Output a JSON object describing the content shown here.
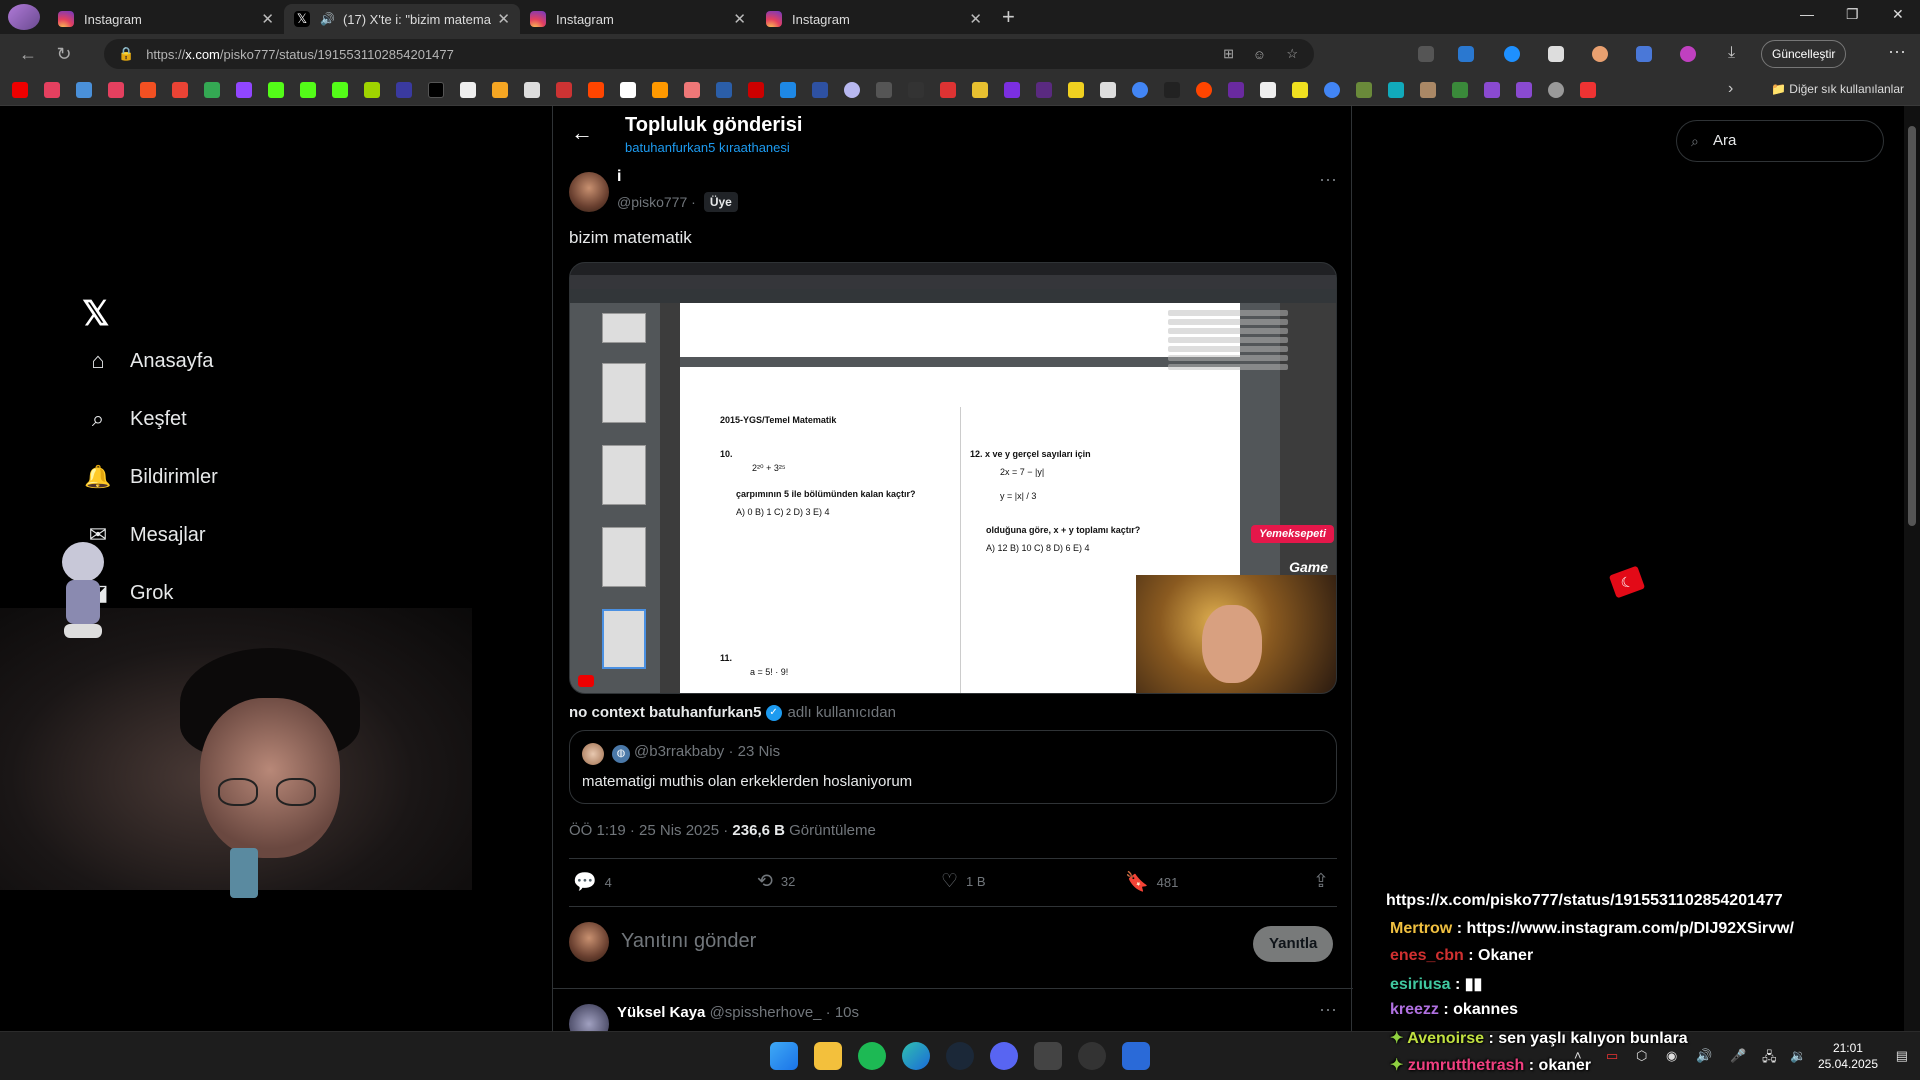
{
  "browser": {
    "tabs": [
      {
        "title": "Instagram",
        "icon": "instagram-icon"
      },
      {
        "title": "(17) X'te i: \"bizim matematik",
        "icon": "x-icon",
        "active": true,
        "audio": true
      },
      {
        "title": "Instagram",
        "icon": "instagram-icon"
      },
      {
        "title": "Instagram",
        "icon": "instagram-icon"
      }
    ],
    "new_tab": "+",
    "url_prefix": "https://",
    "url_domain": "x.com",
    "url_path": "/pisko777/status/1915531102854201477",
    "update_button": "Güncelleştir",
    "other_bookmarks": "Diğer sık kullanılanlar"
  },
  "nav": {
    "logo": "𝕏",
    "items": [
      {
        "label": "Anasayfa",
        "icon": "home-icon",
        "glyph": "⌂"
      },
      {
        "label": "Keşfet",
        "icon": "search-icon",
        "glyph": "⌕"
      },
      {
        "label": "Bildirimler",
        "icon": "bell-icon",
        "glyph": "🔔"
      },
      {
        "label": "Mesajlar",
        "icon": "mail-icon",
        "glyph": "✉"
      },
      {
        "label": "Grok",
        "icon": "grok-icon",
        "glyph": "◪"
      }
    ]
  },
  "header": {
    "title": "Topluluk gönderisi",
    "subtitle": "batuhanfurkan5 kıraathanesi"
  },
  "post": {
    "author": "i",
    "handle": "@pisko777 ·",
    "badge": "Üye",
    "text": "bizim matematik",
    "media": {
      "doc_title": "2015-YGS/Temel Matematik",
      "q10": "10.",
      "q10_expr": "2²⁰ + 3²⁵",
      "q10_text": "çarpımının 5 ile bölümünden kalan kaçtır?",
      "q10_opts": "A) 0      B) 1      C) 2      D) 3      E) 4",
      "q12": "12.  x ve y gerçel sayıları için",
      "q12_eq1": "2x = 7 − |y|",
      "q12_eq2": "y = |x| / 3",
      "q12_text": "olduğuna göre, x + y toplamı kaçtır?",
      "q12_opts": "A) 12      B) 10      C) 8      D) 6      E) 4",
      "q11": "11.",
      "q11_expr": "a = 5! · 9!",
      "sponsor": "Yemeksepeti",
      "sponsor2": "Game"
    },
    "attribution_name": "no context batuhanfurkan5",
    "attribution_suffix": "adlı kullanıcıdan",
    "quote": {
      "handle": "@b3rrakbaby · 23 Nis",
      "text": "matematigi muthis olan erkeklerden hoslaniyorum"
    },
    "meta_time": "ÖÖ 1:19 · 25 Nis 2025 ·",
    "meta_views": "236,6 B",
    "meta_views_label": "Görüntüleme",
    "actions": {
      "replies": "4",
      "reposts": "32",
      "likes": "1 B",
      "bookmarks": "481"
    },
    "reply_placeholder": "Yanıtını gönder",
    "reply_button": "Yanıtla"
  },
  "next_comment": {
    "name": "Yüksel Kaya",
    "handle": "@spissherhove_ · 10s"
  },
  "search": {
    "placeholder": "Ara"
  },
  "chat": {
    "url": "https://x.com/pisko777/status/1915531102854201477",
    "lines": [
      {
        "user": "Mertrow",
        "color": "#f0c040",
        "msg": ": https://www.instagram.com/p/DIJ92XSirvw/"
      },
      {
        "user": "enes_cbn",
        "color": "#d03030",
        "msg": ": Okaner"
      },
      {
        "user": "esiriusa",
        "color": "#40c8a0",
        "msg": ": ▮▮"
      },
      {
        "user": "kreezz",
        "color": "#b070e0",
        "msg": ": okannes"
      },
      {
        "user": "Avenoirse",
        "color": "#c0e040",
        "msg": ": sen yaşlı kalıyon bunlara"
      },
      {
        "user": "zumrutthetrash",
        "color": "#f04080",
        "msg": ": okaner"
      }
    ]
  },
  "taskbar": {
    "time": "21:01",
    "date": "25.04.2025"
  },
  "colors": {
    "accent": "#1d9bf0",
    "bg": "#000000",
    "muted": "#71767b"
  }
}
